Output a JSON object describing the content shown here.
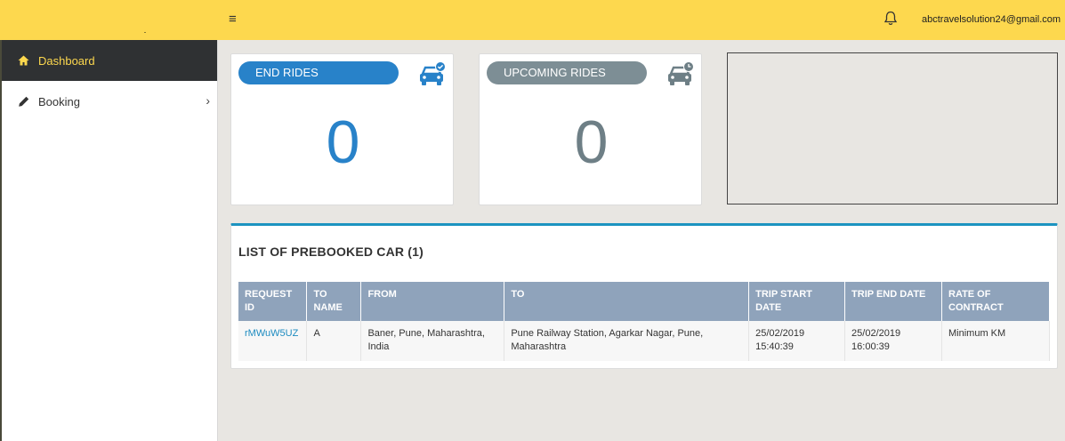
{
  "header": {
    "menu_icon": "hamburger-icon",
    "notification_icon": "bell-icon",
    "user_email": "abctravelsolution24@gmail.com",
    "accent_color": "#fdd84e"
  },
  "sidebar": {
    "items": [
      {
        "label": "Dashboard",
        "icon": "home-icon",
        "active": true
      },
      {
        "label": "Booking",
        "icon": "pencil-icon",
        "active": false,
        "has_submenu": true
      }
    ]
  },
  "stats": {
    "end_rides": {
      "label": "END RIDES",
      "value": "0",
      "color": "#2882c9",
      "icon": "car-check-icon"
    },
    "upcoming_rides": {
      "label": "UPCOMING RIDES",
      "value": "0",
      "color": "#7d8e95",
      "icon": "car-clock-icon"
    }
  },
  "prebooked": {
    "title": "LIST OF PREBOOKED CAR (1)",
    "columns": [
      {
        "line1": "REQUEST",
        "line2": "ID"
      },
      {
        "line1": "TO",
        "line2": "NAME"
      },
      {
        "line1": "FROM",
        "line2": ""
      },
      {
        "line1": "TO",
        "line2": ""
      },
      {
        "line1": "TRIP START",
        "line2": "DATE"
      },
      {
        "line1": "TRIP END DATE",
        "line2": ""
      },
      {
        "line1": "RATE OF",
        "line2": "CONTRACT"
      }
    ],
    "rows": [
      {
        "request_id": "rMWuW5UZ",
        "to_name": "A",
        "from_line1": "Baner, Pune, Maharashtra,",
        "from_line2": "India",
        "to_line1": "Pune Railway Station, Agarkar Nagar, Pune,",
        "to_line2": "Maharashtra",
        "start_date": "25/02/2019",
        "start_time": "15:40:39",
        "end_date": "25/02/2019",
        "end_time": "16:00:39",
        "rate": "Minimum KM"
      }
    ]
  }
}
